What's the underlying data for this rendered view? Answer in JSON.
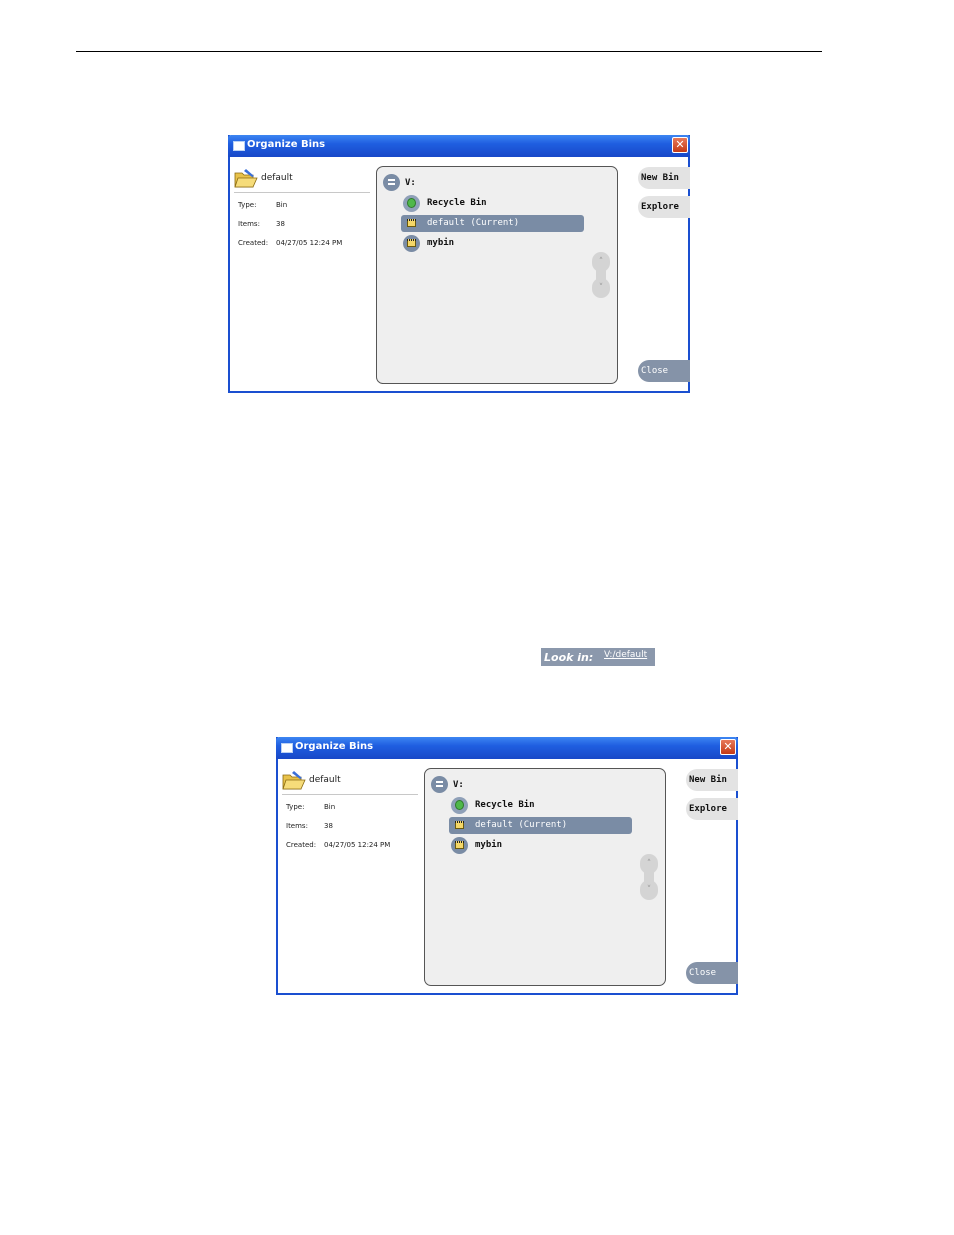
{
  "dialogs": [
    {
      "title": "Organize Bins",
      "close_glyph": "✕",
      "bin_name": "default",
      "info": {
        "type_label": "Type:",
        "type_value": "Bin",
        "items_label": "Items:",
        "items_value": "38",
        "created_label": "Created:",
        "created_value": "04/27/05 12:24 PM"
      },
      "tree": {
        "drive": "V:",
        "items": [
          {
            "label": "Recycle Bin",
            "icon": "recycle-bin-icon"
          },
          {
            "label": "default (Current)",
            "icon": "bin-icon",
            "selected": true
          },
          {
            "label": "mybin",
            "icon": "bin-icon"
          }
        ],
        "scroll_up": "˄",
        "scroll_down": "˅"
      },
      "buttons": {
        "new_bin": "New Bin",
        "explore": "Explore",
        "close": "Close"
      }
    },
    {
      "title": "Organize Bins",
      "close_glyph": "✕",
      "bin_name": "default",
      "info": {
        "type_label": "Type:",
        "type_value": "Bin",
        "items_label": "Items:",
        "items_value": "38",
        "created_label": "Created:",
        "created_value": "04/27/05 12:24 PM"
      },
      "tree": {
        "drive": "V:",
        "items": [
          {
            "label": "Recycle Bin",
            "icon": "recycle-bin-icon"
          },
          {
            "label": "default (Current)",
            "icon": "bin-icon",
            "selected": true
          },
          {
            "label": "mybin",
            "icon": "bin-icon"
          }
        ],
        "scroll_up": "˄",
        "scroll_down": "˅"
      },
      "buttons": {
        "new_bin": "New Bin",
        "explore": "Explore",
        "close": "Close"
      }
    }
  ],
  "look_in": {
    "label": "Look in:",
    "path": "V:/default"
  },
  "colors": {
    "titlebar": "#1f5ee0",
    "selection": "#7a8ca5",
    "close_button": "#8593a8",
    "close_x": "#c43a16"
  }
}
